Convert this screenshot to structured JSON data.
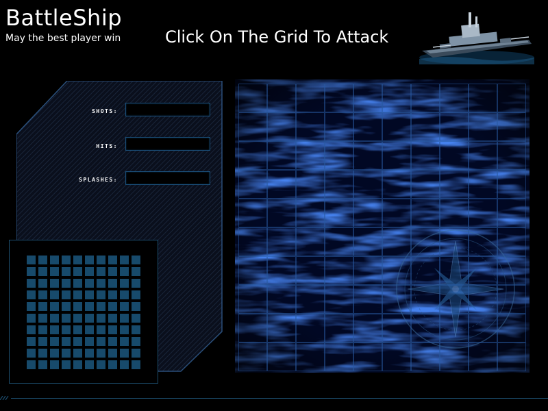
{
  "header": {
    "title": "BattleShip",
    "subtitle": "May the best player win",
    "instruction": "Click On The Grid To Attack"
  },
  "stats": [
    {
      "label": "SHOTS:",
      "value": ""
    },
    {
      "label": "HITS:",
      "value": ""
    },
    {
      "label": "SPLASHES:",
      "value": ""
    }
  ],
  "grid": {
    "rows": 10,
    "columns": 10
  },
  "mini_map": {
    "rows": 10,
    "columns": 10
  },
  "colors": {
    "background": "#000000",
    "accent": "#1c4d6e",
    "mini_cell": "#174a6b",
    "water_dark": "#020a2a",
    "water_light": "#2d6fd6"
  },
  "icons": {
    "battleship": "battleship-image",
    "compass": "compass-rose"
  }
}
